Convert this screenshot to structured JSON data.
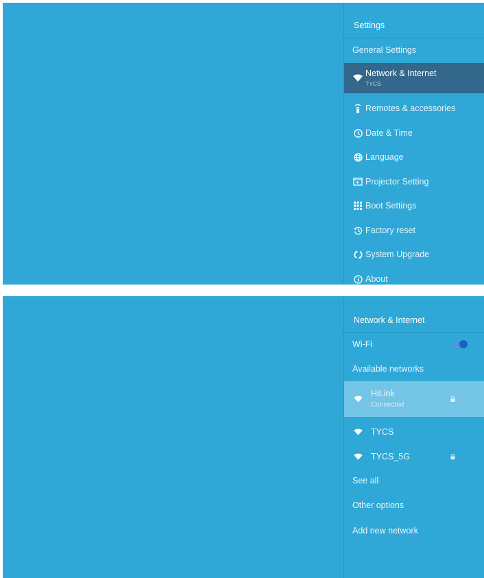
{
  "settings_panel": {
    "title": "Settings",
    "items": [
      {
        "label": "General Settings",
        "icon": "none"
      },
      {
        "label": "Network & Internet",
        "sublabel": "TYCS",
        "icon": "wifi-icon",
        "selected": true
      },
      {
        "label": "Remotes & accessories",
        "icon": "remote-icon"
      },
      {
        "label": "Date & Time",
        "icon": "clock-icon"
      },
      {
        "label": "Language",
        "icon": "globe-icon"
      },
      {
        "label": "Projector Setting",
        "icon": "projector-icon"
      },
      {
        "label": "Boot Settings",
        "icon": "grid-icon"
      },
      {
        "label": "Factory reset",
        "icon": "history-icon"
      },
      {
        "label": "System Upgrade",
        "icon": "sync-icon"
      },
      {
        "label": "About",
        "icon": "info-icon"
      }
    ]
  },
  "network_panel": {
    "title": "Network & Internet",
    "wifi_label": "Wi-Fi",
    "wifi_enabled": true,
    "available_label": "Available networks",
    "networks": [
      {
        "name": "HiLink",
        "status": "Connected",
        "locked": true
      },
      {
        "name": "TYCS",
        "locked": false
      },
      {
        "name": "TYCS_5G",
        "locked": true
      }
    ],
    "see_all": "See all",
    "other_options": "Other options",
    "add_network": "Add new network"
  },
  "colors": {
    "background": "#2fa8d8",
    "selected_item": "#33678b",
    "connected_row": "#74c4e6",
    "toggle_on": "#1565c0"
  }
}
